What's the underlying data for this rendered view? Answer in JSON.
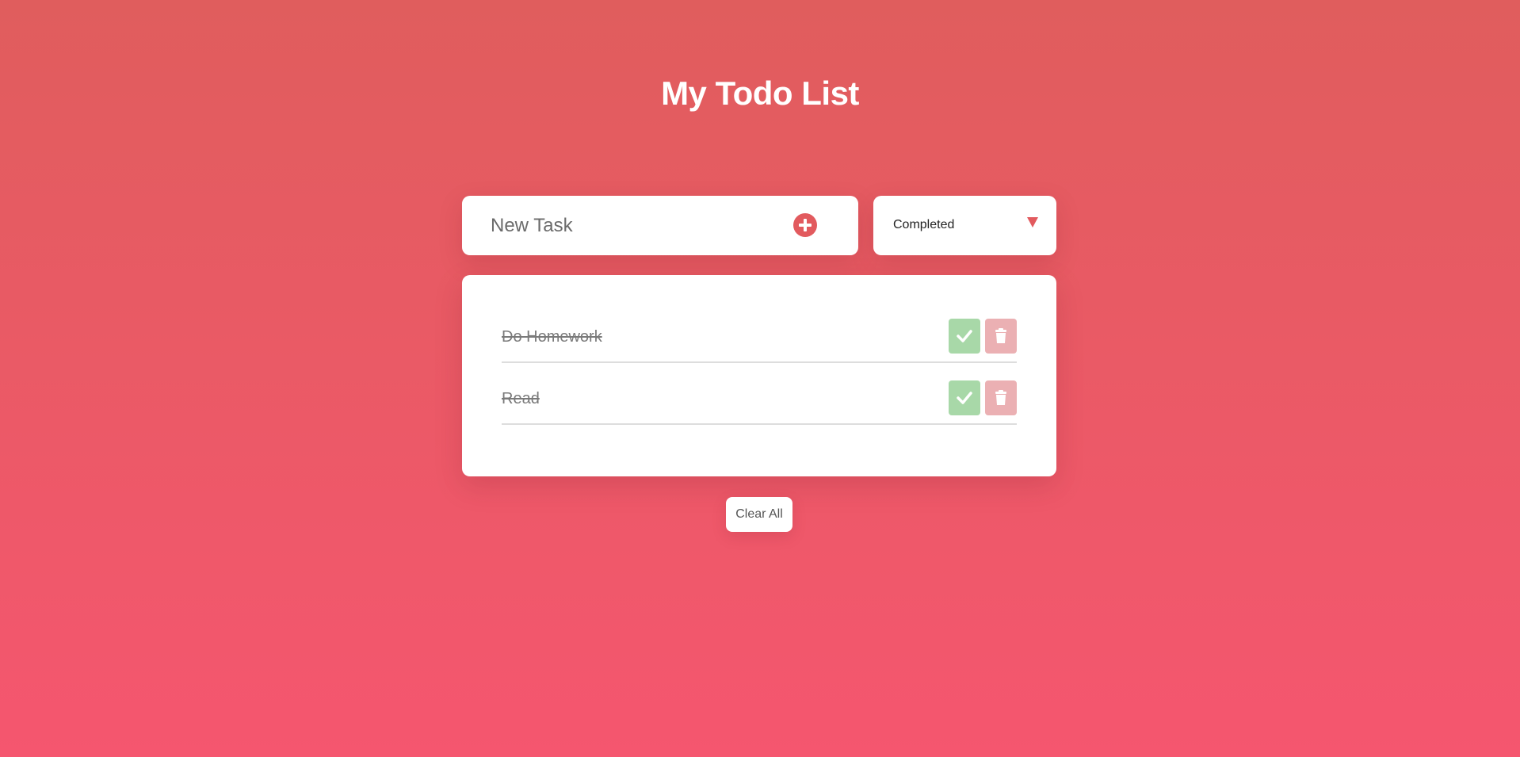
{
  "page": {
    "title": "My Todo List"
  },
  "input": {
    "placeholder": "New Task",
    "value": "",
    "add_icon": "plus-circle-icon"
  },
  "filter": {
    "selected": "Completed",
    "arrow_icon": "triangle-down-icon"
  },
  "todos": [
    {
      "text": "Do Homework",
      "completed": true
    },
    {
      "text": "Read",
      "completed": true
    }
  ],
  "actions": {
    "clear_label": "Clear All",
    "check_icon": "check-icon",
    "delete_icon": "trash-icon"
  },
  "colors": {
    "background_top": "#e05d5d",
    "background_bottom": "#f5566f",
    "accent": "#e25a5e",
    "check_button": "#a8d8a8",
    "delete_button": "#ebb0b3"
  }
}
